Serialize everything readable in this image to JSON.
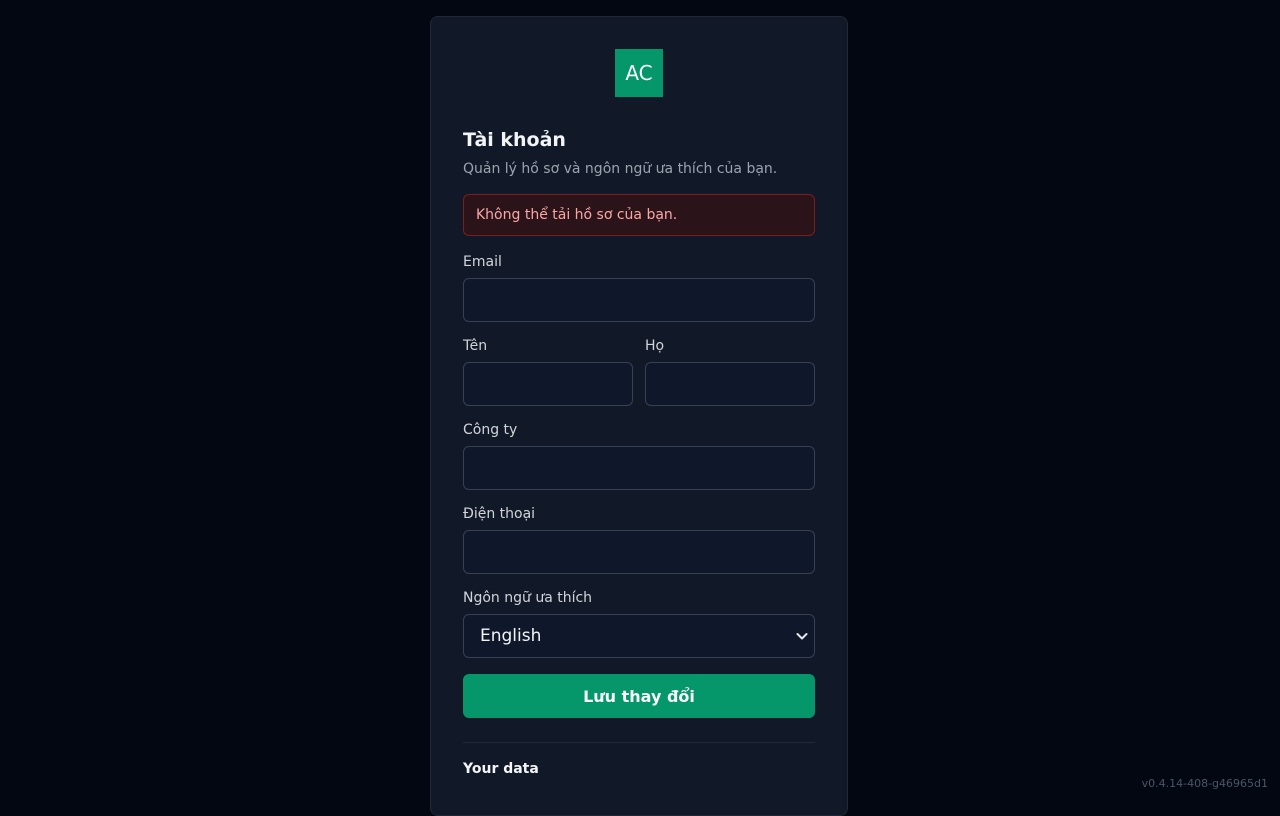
{
  "brand": {
    "logo_text": "AC",
    "accent": "#059669"
  },
  "page": {
    "title": "Tài khoản",
    "subtitle": "Quản lý hồ sơ và ngôn ngữ ưa thích của bạn."
  },
  "alert": {
    "message": "Không thể tải hồ sơ của bạn.",
    "color": "#fca5a5"
  },
  "form": {
    "email": {
      "label": "Email",
      "value": ""
    },
    "first_name": {
      "label": "Tên",
      "value": ""
    },
    "last_name": {
      "label": "Họ",
      "value": ""
    },
    "company": {
      "label": "Công ty",
      "value": ""
    },
    "phone": {
      "label": "Điện thoại",
      "value": ""
    },
    "language": {
      "label": "Ngôn ngữ ưa thích",
      "selected": "English"
    },
    "save_label": "Lưu thay đổi"
  },
  "your_data": {
    "title": "Your data"
  },
  "footer": {
    "version": "v0.4.14-408-g46965d1"
  }
}
